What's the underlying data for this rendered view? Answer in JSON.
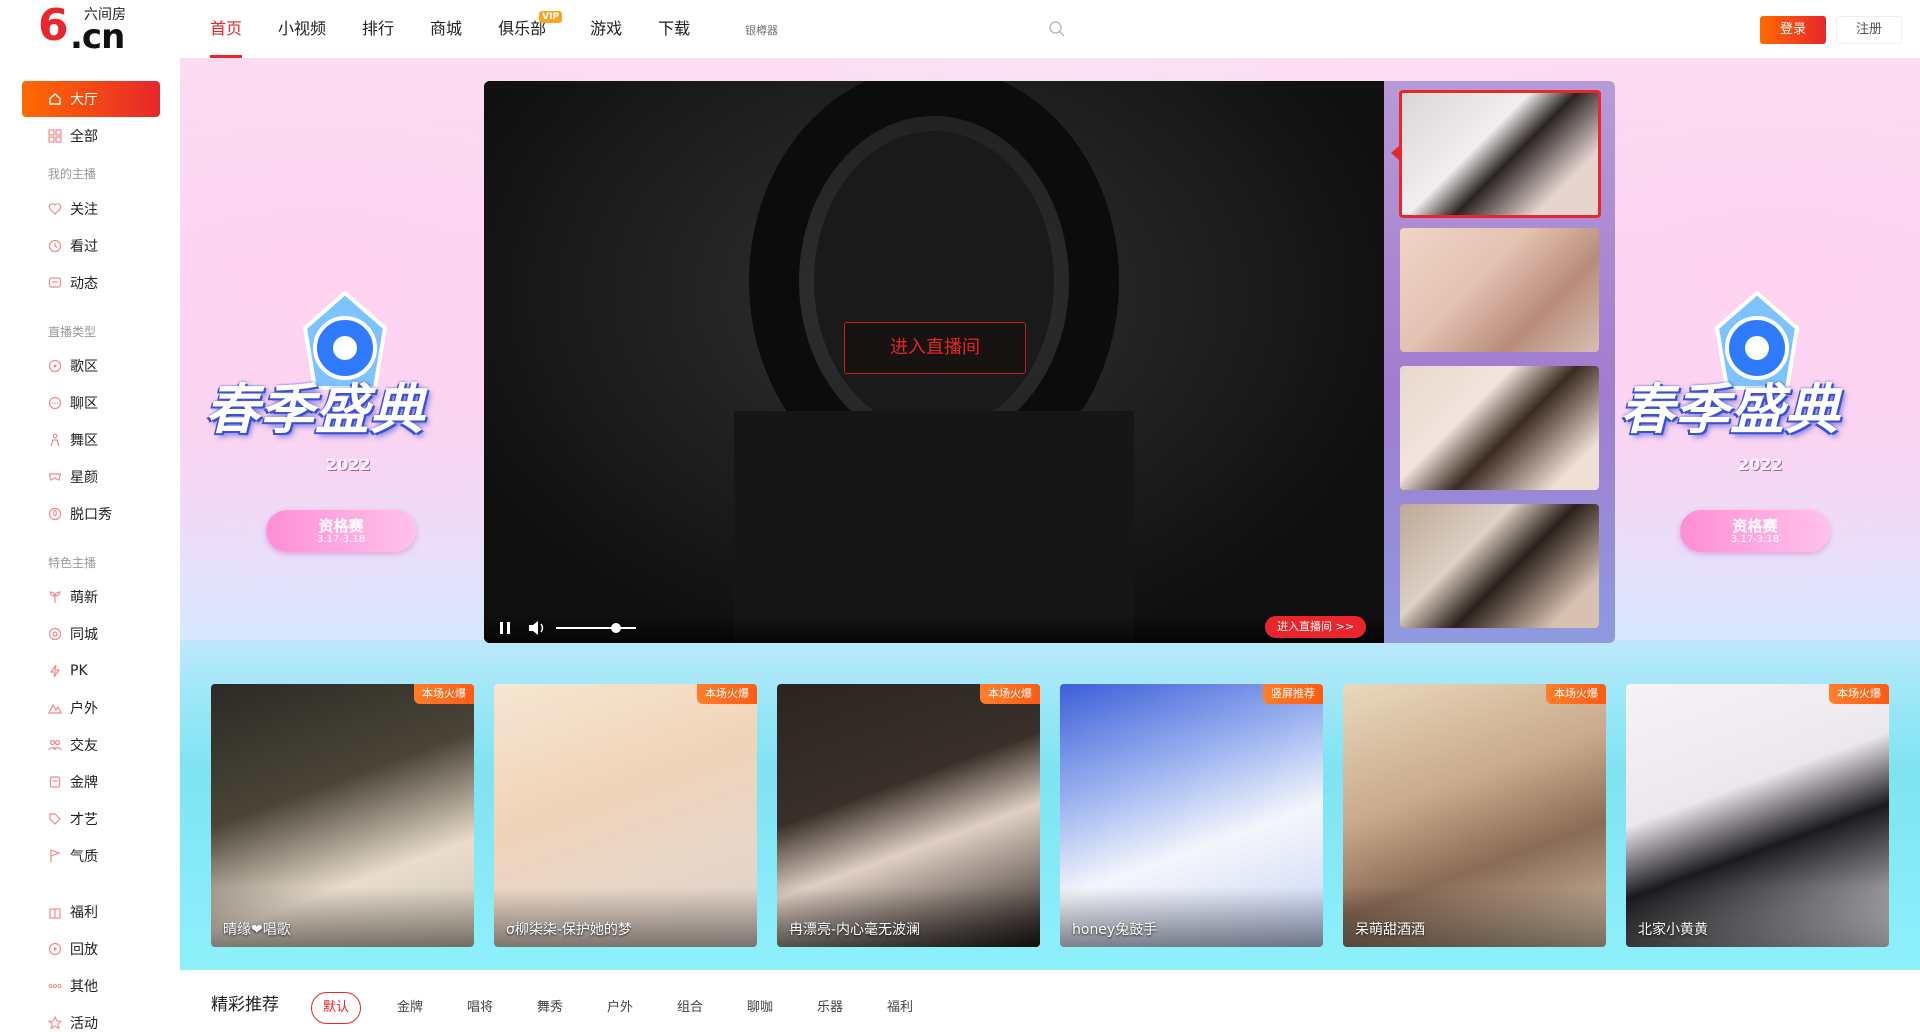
{
  "header": {
    "logo_text": ".cn",
    "logo_six": "6",
    "logo_sub": "六间房",
    "nav": [
      {
        "label": "首页"
      },
      {
        "label": "小视频"
      },
      {
        "label": "排行"
      },
      {
        "label": "商城"
      },
      {
        "label": "俱乐部"
      },
      {
        "label": "游戏"
      },
      {
        "label": "下载"
      }
    ],
    "vip_badge": "VIP",
    "search_placeholder": "银樽器",
    "login": "登录",
    "register": "注册"
  },
  "sidebar": {
    "items": [
      {
        "label": "大厅",
        "icon": "home-icon"
      },
      {
        "label": "全部",
        "icon": "grid-icon"
      }
    ],
    "section_anchor": "我的主播",
    "anchor_items": [
      {
        "label": "关注"
      },
      {
        "label": "看过"
      },
      {
        "label": "动态"
      }
    ],
    "section_type": "直播类型",
    "type_items": [
      {
        "label": "歌区"
      },
      {
        "label": "聊区"
      },
      {
        "label": "舞区"
      },
      {
        "label": "星颜"
      },
      {
        "label": "脱口秀"
      }
    ],
    "section_feature": "特色主播",
    "feature_items": [
      {
        "label": "萌新"
      },
      {
        "label": "同城"
      },
      {
        "label": "PK"
      },
      {
        "label": "户外"
      },
      {
        "label": "交友"
      },
      {
        "label": "金牌"
      },
      {
        "label": "才艺"
      },
      {
        "label": "气质"
      }
    ],
    "extra_items": [
      {
        "label": "福利"
      },
      {
        "label": "回放"
      },
      {
        "label": "其他"
      },
      {
        "label": "活动"
      }
    ]
  },
  "banner": {
    "title": "春季盛典",
    "year": "2022",
    "pill_text": "资格赛",
    "pill_date": "3.17-3.18"
  },
  "player": {
    "enter_room": "进入直播间",
    "enter_room_small": "进入直播间 >>",
    "volume_level": 0.75
  },
  "cards": [
    {
      "name": "晴缘❤唱歌",
      "tag": "本场火爆"
    },
    {
      "name": "σ柳柒柒-保护她的梦",
      "tag": "本场火爆"
    },
    {
      "name": "冉漂亮-内心毫无波澜",
      "tag": "本场火爆"
    },
    {
      "name": "honey兔鼓手",
      "tag": "竖屏推荐"
    },
    {
      "name": "呆萌甜酒酒",
      "tag": "本场火爆"
    },
    {
      "name": "北家小黄黄",
      "tag": "本场火爆"
    }
  ],
  "recommend": {
    "title": "精彩推荐",
    "tabs": [
      "默认",
      "金牌",
      "唱将",
      "舞秀",
      "户外",
      "组合",
      "聊咖",
      "乐器",
      "福利"
    ]
  },
  "colors": {
    "brand_red": "#e8262b",
    "brand_orange": "#ff6a00"
  }
}
